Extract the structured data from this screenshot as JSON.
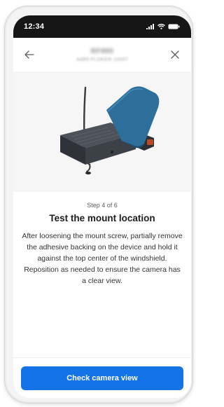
{
  "status_bar": {
    "time": "12:34",
    "icons": [
      "cellular-signal-icon",
      "wifi-icon",
      "battery-icon"
    ]
  },
  "nav": {
    "back_icon": "arrow-left-icon",
    "title": "RF880",
    "subtitle": "A4B5-FLOKER-10007",
    "close_icon": "close-icon"
  },
  "hero": {
    "image": "dashcam-mount-illustration"
  },
  "content": {
    "step_label": "Step 4 of 6",
    "title": "Test the mount location",
    "body": "After loosening the mount screw, partially remove the adhesive backing on the device and hold it against the top center of the windshield. Reposition as needed to ensure the camera has a clear view."
  },
  "footer": {
    "cta_label": "Check camera view"
  },
  "colors": {
    "accent": "#1473e6",
    "status_bar": "#161616",
    "mount": "#2d6f9a"
  }
}
